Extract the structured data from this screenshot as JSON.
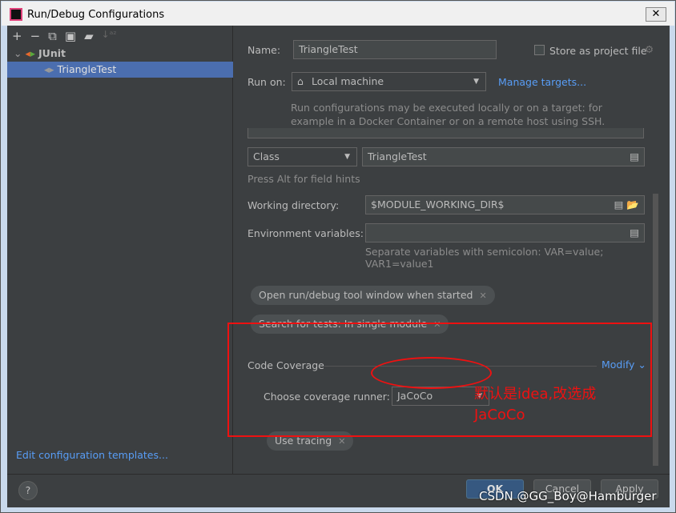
{
  "window": {
    "title": "Run/Debug Configurations",
    "close": "✕"
  },
  "toolbar": {
    "icons": [
      "plus-icon",
      "minus-icon",
      "copy-icon",
      "save-icon",
      "new-folder-icon",
      "sort-icon"
    ],
    "glyphs": [
      "+",
      "−",
      "⧉",
      "▣",
      "▰",
      "↓ᵃᶻ"
    ]
  },
  "tree": {
    "group": "JUnit",
    "item": "TriangleTest"
  },
  "edit_templates": "Edit configuration templates...",
  "form": {
    "name_label": "Name:",
    "name_value": "TriangleTest",
    "store_label": "Store as project file",
    "run_on_label": "Run on:",
    "run_on_value": "Local machine",
    "manage_targets": "Manage targets...",
    "run_on_hint": [
      "Run configurations may be executed locally or on a target: for",
      "example in a Docker Container or on a remote host using SSH."
    ],
    "kind_value": "Class",
    "class_value": "TriangleTest",
    "alt_hint": "Press Alt for field hints",
    "workdir_label": "Working directory:",
    "workdir_value": "$MODULE_WORKING_DIR$",
    "env_label": "Environment variables:",
    "env_value": "",
    "env_hint": "Separate variables with semicolon: VAR=value; VAR1=value1",
    "chips": [
      "Open run/debug tool window when started",
      "Search for tests: In single module"
    ],
    "coverage_title": "Code Coverage",
    "modify": "Modify",
    "runner_label": "Choose coverage runner:",
    "runner_value": "JaCoCo",
    "tracing_chip": "Use tracing"
  },
  "annotation": [
    "默认是idea,改选成",
    "JaCoCo"
  ],
  "buttons": {
    "help": "?",
    "ok": "OK",
    "cancel": "Cancel",
    "apply": "Apply"
  },
  "watermark": "CSDN @GG_Boy@Hamburger"
}
